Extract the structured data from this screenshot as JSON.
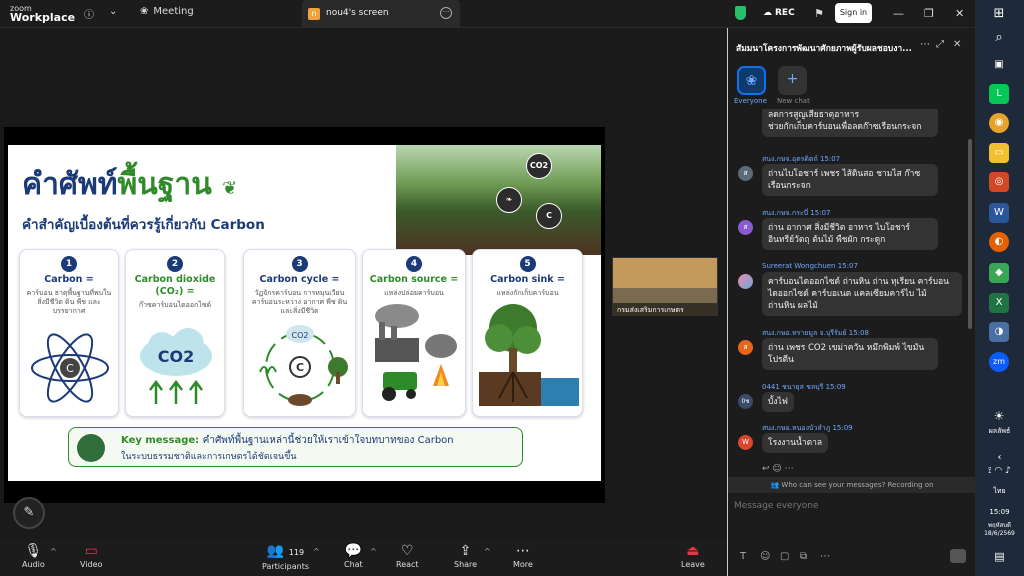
{
  "app": {
    "logo_line1": "zoom",
    "logo_line2": "Workplace"
  },
  "topbar": {
    "meeting_label": "Meeting",
    "share_tab": "nou4's screen",
    "rec_label": "REC",
    "signin_label": "Sign in"
  },
  "slide": {
    "title_part1": "คำศัพท์",
    "title_part2": "พื้นฐาน",
    "subtitle": "คำสำคัญเบื้องต้นที่ควรรู้เกี่ยวกับ Carbon",
    "field_labels": [
      "CO2",
      "C"
    ],
    "cards": [
      {
        "num": "1",
        "title": "Carbon =",
        "desc": "คาร์บอน ธาตุพื้นฐานที่พบในสิ่งมีชีวิต ดิน พืช และบรรยากาศ"
      },
      {
        "num": "2",
        "title": "Carbon dioxide (CO₂) =",
        "desc": "ก๊าซคาร์บอนไดออกไซด์"
      },
      {
        "num": "3",
        "title": "Carbon cycle =",
        "desc": "วัฏจักรคาร์บอน การหมุนเวียนคาร์บอนระหว่าง อากาศ พืช ดิน และสิ่งมีชีวิต"
      },
      {
        "num": "4",
        "title": "Carbon source =",
        "desc": "แหล่งปล่อยคาร์บอน"
      },
      {
        "num": "5",
        "title": "Carbon sink =",
        "desc": "แหล่งกักเก็บคาร์บอน"
      }
    ],
    "card_icon_labels": [
      "C",
      "CO2",
      "CO2",
      "C"
    ],
    "key_label": "Key message:",
    "key_line1": "คำศัพท์พื้นฐานเหล่านี้ช่วยให้เราเข้าใจบทบาทของ Carbon",
    "key_line2": "ในระบบธรรมชาติและการเกษตรได้ชัดเจนขึ้น"
  },
  "video_thumb": {
    "name": "กรมส่งเสริมการเกษตร"
  },
  "bottombar": {
    "audio": "Audio",
    "video": "Video",
    "participants": "Participants",
    "participant_count": "119",
    "chat": "Chat",
    "react": "React",
    "share": "Share",
    "more": "More",
    "leave": "Leave"
  },
  "chat": {
    "title": "สัมมนาโครงการพัฒนาศักยภาพผู้รับผลชอบงา...",
    "tab_everyone": "Everyone",
    "tab_new": "New chat",
    "messages": [
      {
        "initial": "",
        "name": "",
        "text1": "ลดการสูญเสียธาตุอาหาร",
        "text2": "ช่วยกักเก็บคาร์บอนเพื่อลดก๊าซเรือนกระจก"
      },
      {
        "initial": "ส",
        "name": "สนง.กษจ.อุตรดิตถ์ 15:07",
        "text1": "ถ่านไบโอชาร์ เพชร ไส้ดินสอ ชามไส ก๊าซ",
        "text2": "เรือนกระจก"
      },
      {
        "initial": "ส",
        "name": "สนง.กษจ.กระบี่ 15:07",
        "text1": "ถ่าน อากาศ สิ่งมีชีวิต อาหาร ไบโอชาร์",
        "text2": "อินทรีย์วัตถุ ต้นไม้ พืชผัก กระดูก"
      },
      {
        "initial": "",
        "name": "Sureerat Wongchuen 15:07",
        "text1": "คาร์บอนไดออกไซด์ ถ่านหิน ถ่าน ทุเรียน คาร์บอน",
        "text2": "ไดออกไซด์ คาร์บอเนต แคลเซียมคาร์ไบ ไม้",
        "text3": "ถ่านหิน ผลไม้"
      },
      {
        "initial": "ส",
        "name": "สนง.กษอ.ทรายมูล จ.บุรีรัมย์ 15:08",
        "text1": "ถ่าน เพชร CO2 เขม่าควัน หมึกพิมพ์ ไขมัน",
        "text2": "โปรตีน"
      },
      {
        "initial": "0ช",
        "name": "0441 ชนายุส ชลบุรี 15:09",
        "text1": "บั้งไฟ"
      },
      {
        "initial": "W",
        "name": "สนง.กษอ.หนองบัวลำภู 15:09",
        "text1": "โรงงานน้ำตาล"
      }
    ],
    "who_can_see": "Who can see your messages? Recording on",
    "compose_placeholder": "Message everyone"
  },
  "taskbar": {
    "lang": "ไทย",
    "time": "15:09",
    "date_line1": "พฤหัสบดี",
    "date_line2": "18/6/2569",
    "weather": "ผลลัพธ์"
  },
  "colors": {
    "brand_blue": "#1b3a78",
    "brand_green": "#2f8a2a",
    "link_blue": "#6ea8ff",
    "accent": "#0e72ed"
  }
}
